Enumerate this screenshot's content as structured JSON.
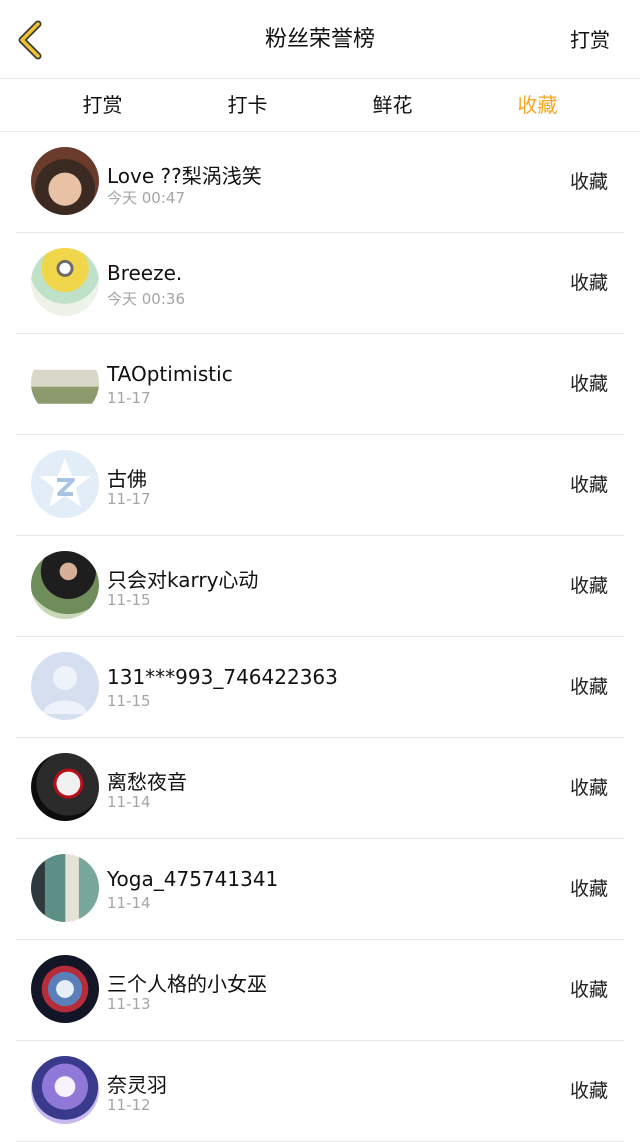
{
  "header": {
    "title": "粉丝荣誉榜",
    "right_action": "打赏"
  },
  "tabs": [
    {
      "label": "打赏"
    },
    {
      "label": "打卡"
    },
    {
      "label": "鲜花"
    },
    {
      "label": "收藏",
      "active": true
    }
  ],
  "colors": {
    "accent": "#f5a623",
    "divider": "#e6e6e6",
    "secondary_text": "#a5a5a5"
  },
  "fans": [
    {
      "name": "Love ??梨涡浅笑",
      "time": "今天 00:47",
      "action": "收藏"
    },
    {
      "name": "Breeze.",
      "time": "今天 00:36",
      "action": "收藏"
    },
    {
      "name": "TAOptimistic",
      "time": "11-17",
      "action": "收藏"
    },
    {
      "name": "古佛",
      "time": "11-17",
      "action": "收藏"
    },
    {
      "name": "只会对karry心动",
      "time": "11-15",
      "action": "收藏"
    },
    {
      "name": "131***993_746422363",
      "time": "11-15",
      "action": "收藏"
    },
    {
      "name": "离愁夜音",
      "time": "11-14",
      "action": "收藏"
    },
    {
      "name": "Yoga_475741341",
      "time": "11-14",
      "action": "收藏"
    },
    {
      "name": "三个人格的小女巫",
      "time": "11-13",
      "action": "收藏"
    },
    {
      "name": "奈灵羽",
      "time": "11-12",
      "action": "收藏"
    }
  ]
}
